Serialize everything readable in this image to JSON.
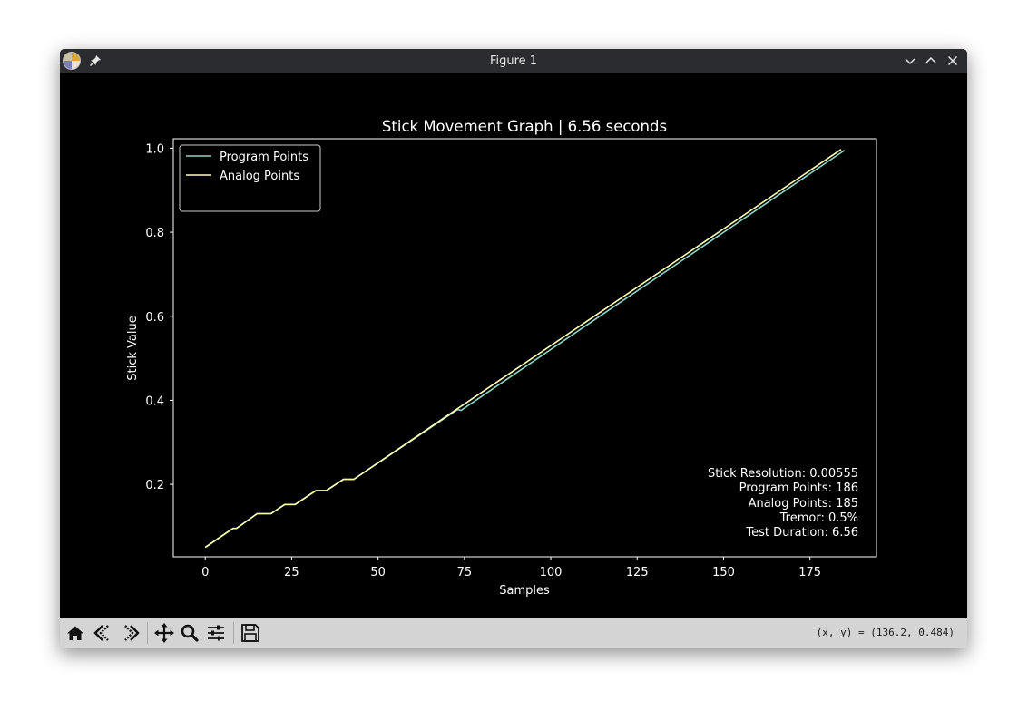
{
  "window": {
    "title": "Figure 1"
  },
  "toolbar": {
    "coords_text": "(x, y) = (136.2, 0.484)"
  },
  "colors": {
    "program": "#8dd3c7",
    "analog": "#ffffb3",
    "background": "#000000",
    "foreground": "#ffffff"
  },
  "chart_data": {
    "type": "line",
    "title": "Stick Movement Graph | 6.56 seconds",
    "xlabel": "Samples",
    "ylabel": "Stick Value",
    "xlim": [
      -9.25,
      194.25
    ],
    "ylim": [
      0.0275,
      1.0225
    ],
    "xticks": [
      0,
      25,
      50,
      75,
      100,
      125,
      150,
      175
    ],
    "xtick_labels": [
      "0",
      "25",
      "50",
      "75",
      "100",
      "125",
      "150",
      "175"
    ],
    "yticks": [
      0.2,
      0.4,
      0.6,
      0.8,
      1.0
    ],
    "ytick_labels": [
      "0.2",
      "0.4",
      "0.6",
      "0.8",
      "1.0"
    ],
    "legend_position": "upper-left",
    "series": [
      {
        "name": "Program Points",
        "color": "#8dd3c7",
        "points": [
          [
            0,
            0.05
          ],
          [
            8,
            0.095
          ],
          [
            9,
            0.095
          ],
          [
            15,
            0.13
          ],
          [
            19,
            0.13
          ],
          [
            23,
            0.152
          ],
          [
            26,
            0.152
          ],
          [
            32,
            0.185
          ],
          [
            35,
            0.185
          ],
          [
            40,
            0.212
          ],
          [
            43,
            0.212
          ],
          [
            73,
            0.378
          ],
          [
            74,
            0.376
          ],
          [
            185,
            0.995
          ]
        ]
      },
      {
        "name": "Analog Points",
        "color": "#ffffb3",
        "points": [
          [
            0,
            0.05
          ],
          [
            8,
            0.095
          ],
          [
            9,
            0.095
          ],
          [
            15,
            0.13
          ],
          [
            19,
            0.13
          ],
          [
            23,
            0.152
          ],
          [
            26,
            0.152
          ],
          [
            32,
            0.185
          ],
          [
            35,
            0.185
          ],
          [
            40,
            0.212
          ],
          [
            43,
            0.212
          ],
          [
            73,
            0.38
          ],
          [
            184,
            0.997
          ]
        ]
      }
    ],
    "stats": [
      "Stick Resolution: 0.00555",
      "Program Points: 186",
      "Analog Points: 185",
      "Tremor: 0.5%",
      "Test Duration: 6.56"
    ]
  }
}
